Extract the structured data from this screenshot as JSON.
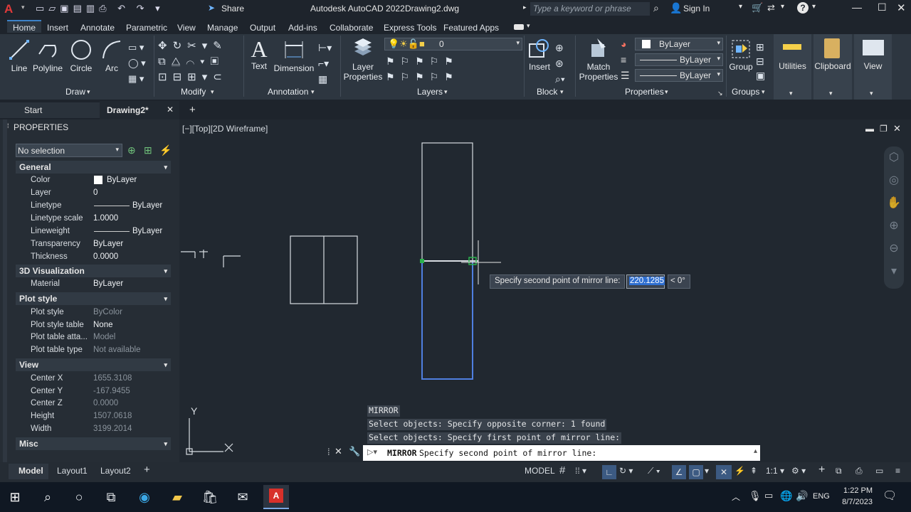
{
  "titlebar": {
    "app_title": "Autodesk AutoCAD 2022",
    "file_name": "Drawing2.dwg",
    "share": "Share",
    "search_placeholder": "Type a keyword or phrase",
    "sign_in": "Sign In"
  },
  "ribbon_tabs": [
    "Home",
    "Insert",
    "Annotate",
    "Parametric",
    "View",
    "Manage",
    "Output",
    "Add-ins",
    "Collaborate",
    "Express Tools",
    "Featured Apps"
  ],
  "ribbon": {
    "draw": {
      "line": "Line",
      "polyline": "Polyline",
      "circle": "Circle",
      "arc": "Arc",
      "panel": "Draw"
    },
    "modify": {
      "panel": "Modify"
    },
    "annotation": {
      "text": "Text",
      "dimension": "Dimension",
      "panel": "Annotation"
    },
    "layers": {
      "layer_properties_1": "Layer",
      "layer_properties_2": "Properties",
      "current_layer": "0",
      "panel": "Layers"
    },
    "block": {
      "insert": "Insert",
      "panel": "Block"
    },
    "properties": {
      "match_1": "Match",
      "match_2": "Properties",
      "color": "ByLayer",
      "linetype": "ByLayer",
      "lineweight": "ByLayer",
      "panel": "Properties"
    },
    "groups": {
      "group": "Group",
      "panel": "Groups"
    },
    "utilities": "Utilities",
    "clipboard": "Clipboard",
    "view": "View"
  },
  "doc_tabs": {
    "start": "Start",
    "drawing": "Drawing2*"
  },
  "viewport_label": "[−][Top][2D Wireframe]",
  "properties_panel": {
    "title": "PROPERTIES",
    "selection": "No selection",
    "sections": {
      "general": "General",
      "visualization": "3D Visualization",
      "plot_style": "Plot style",
      "view": "View",
      "misc": "Misc"
    },
    "general_rows": [
      {
        "k": "Color",
        "v": "ByLayer"
      },
      {
        "k": "Layer",
        "v": "0"
      },
      {
        "k": "Linetype",
        "v": "ByLayer"
      },
      {
        "k": "Linetype scale",
        "v": "1.0000"
      },
      {
        "k": "Lineweight",
        "v": "ByLayer"
      },
      {
        "k": "Transparency",
        "v": "ByLayer"
      },
      {
        "k": "Thickness",
        "v": "0.0000"
      }
    ],
    "vis_rows": [
      {
        "k": "Material",
        "v": "ByLayer"
      }
    ],
    "plot_rows": [
      {
        "k": "Plot style",
        "v": "ByColor"
      },
      {
        "k": "Plot style table",
        "v": "None"
      },
      {
        "k": "Plot table atta...",
        "v": "Model"
      },
      {
        "k": "Plot table type",
        "v": "Not available"
      }
    ],
    "view_rows": [
      {
        "k": "Center X",
        "v": "1655.3108"
      },
      {
        "k": "Center Y",
        "v": "-167.9455"
      },
      {
        "k": "Center Z",
        "v": "0.0000"
      },
      {
        "k": "Height",
        "v": "1507.0618"
      },
      {
        "k": "Width",
        "v": "3199.2014"
      }
    ]
  },
  "tooltip": {
    "prompt": "Specify second point of mirror line:",
    "value": "220.1285",
    "angle": "< 0°"
  },
  "ucs": {
    "x": "X",
    "y": "Y"
  },
  "command_history": [
    "MIRROR",
    "Select objects: Specify opposite corner: 1 found",
    "Select objects:  Specify first point of mirror line:"
  ],
  "command_line": {
    "cmd": "MIRROR",
    "text": "Specify second point of mirror line:"
  },
  "layout_tabs": [
    "Model",
    "Layout1",
    "Layout2"
  ],
  "status": {
    "model": "MODEL",
    "scale": "1:1"
  },
  "taskbar": {
    "time": "1:22 PM",
    "date": "8/7/2023",
    "lang": "ENG"
  },
  "colors": {
    "selection_blue": "#4f7fe0",
    "accent": "#3c82c8",
    "bg": "#212830"
  }
}
